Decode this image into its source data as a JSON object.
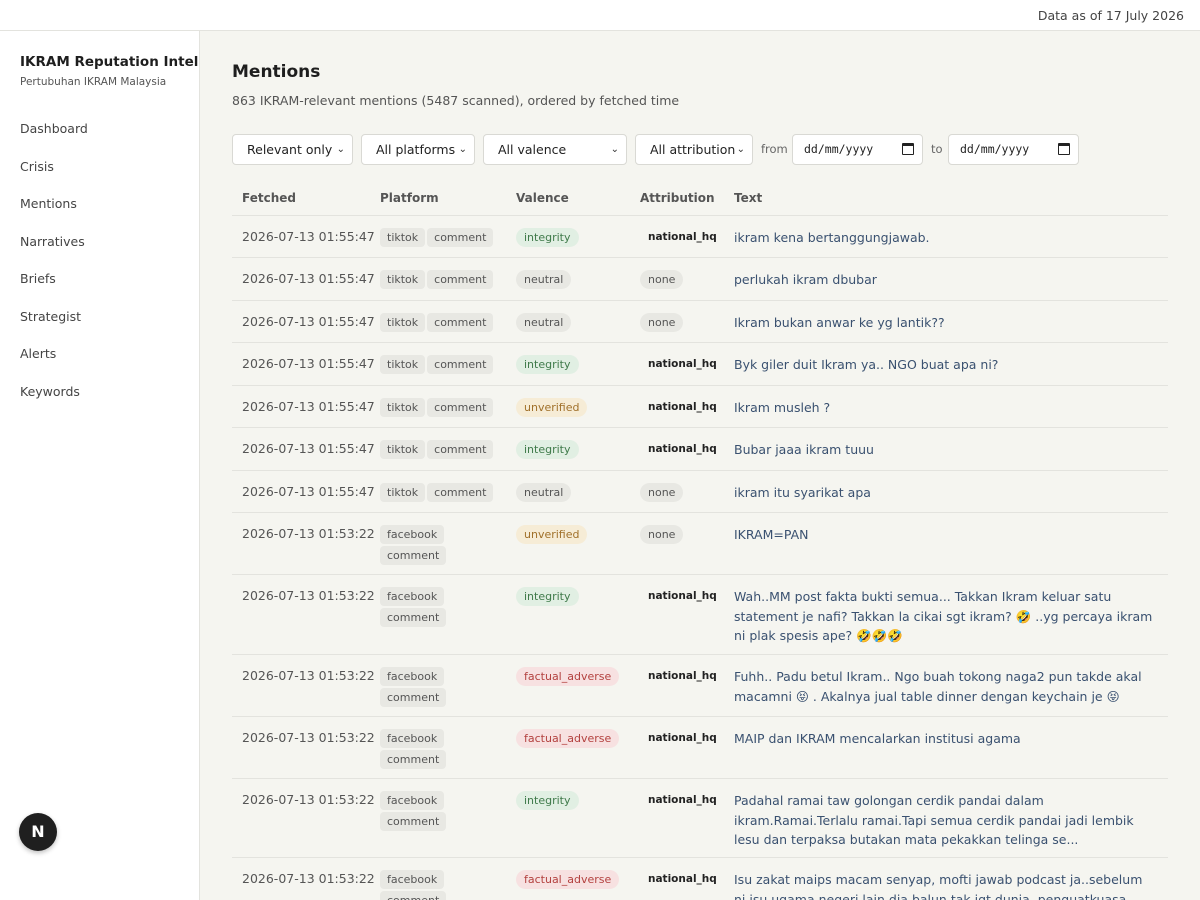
{
  "topbar": {
    "as_of": "Data as of 17 July 2026"
  },
  "sidebar": {
    "brand_title": "IKRAM Reputation Intel",
    "brand_subtitle": "Pertubuhan IKRAM Malaysia",
    "items": [
      {
        "label": "Dashboard"
      },
      {
        "label": "Crisis"
      },
      {
        "label": "Mentions"
      },
      {
        "label": "Narratives"
      },
      {
        "label": "Briefs"
      },
      {
        "label": "Strategist"
      },
      {
        "label": "Alerts"
      },
      {
        "label": "Keywords"
      }
    ],
    "badge": "N"
  },
  "page": {
    "title": "Mentions",
    "subtitle": "863 IKRAM-relevant mentions (5487 scanned), ordered by fetched time"
  },
  "filters": {
    "relevance": "Relevant only",
    "platform": "All platforms",
    "valence": "All valence",
    "attribution": "All attribution",
    "from_label": "from",
    "to_label": "to",
    "from_placeholder": "dd/mm/yyyy",
    "to_placeholder": "dd/mm/yyyy"
  },
  "table": {
    "headers": {
      "fetched": "Fetched",
      "platform": "Platform",
      "valence": "Valence",
      "attribution": "Attribution",
      "text": "Text"
    },
    "rows": [
      {
        "fetched": "2026-07-13 01:55:47",
        "platform": "tiktok",
        "kind": "comment",
        "valence": "integrity",
        "attribution": "national_hq",
        "text": "ikram kena bertanggungjawab."
      },
      {
        "fetched": "2026-07-13 01:55:47",
        "platform": "tiktok",
        "kind": "comment",
        "valence": "neutral",
        "attribution": "none",
        "text": "perlukah ikram dbubar"
      },
      {
        "fetched": "2026-07-13 01:55:47",
        "platform": "tiktok",
        "kind": "comment",
        "valence": "neutral",
        "attribution": "none",
        "text": "Ikram bukan anwar ke yg lantik??"
      },
      {
        "fetched": "2026-07-13 01:55:47",
        "platform": "tiktok",
        "kind": "comment",
        "valence": "integrity",
        "attribution": "national_hq",
        "text": "Byk giler duit Ikram ya.. NGO buat apa ni?"
      },
      {
        "fetched": "2026-07-13 01:55:47",
        "platform": "tiktok",
        "kind": "comment",
        "valence": "unverified",
        "attribution": "national_hq",
        "text": "Ikram musleh ?"
      },
      {
        "fetched": "2026-07-13 01:55:47",
        "platform": "tiktok",
        "kind": "comment",
        "valence": "integrity",
        "attribution": "national_hq",
        "text": "Bubar jaaa ikram tuuu"
      },
      {
        "fetched": "2026-07-13 01:55:47",
        "platform": "tiktok",
        "kind": "comment",
        "valence": "neutral",
        "attribution": "none",
        "text": "ikram itu syarikat apa"
      },
      {
        "fetched": "2026-07-13 01:53:22",
        "platform": "facebook",
        "kind": "comment",
        "valence": "unverified",
        "attribution": "none",
        "text": "IKRAM=PAN"
      },
      {
        "fetched": "2026-07-13 01:53:22",
        "platform": "facebook",
        "kind": "comment",
        "valence": "integrity",
        "attribution": "national_hq",
        "text": "Wah..MM post fakta bukti semua... Takkan Ikram keluar satu statement je nafi? Takkan la cikai sgt ikram? 🤣 ..yg percaya ikram ni plak spesis ape? 🤣🤣🤣"
      },
      {
        "fetched": "2026-07-13 01:53:22",
        "platform": "facebook",
        "kind": "comment",
        "valence": "factual_adverse",
        "attribution": "national_hq",
        "text": "Fuhh.. Padu betul Ikram.. Ngo buah tokong naga2 pun takde akal macamni 😝 . Akalnya jual table dinner dengan keychain je 😝"
      },
      {
        "fetched": "2026-07-13 01:53:22",
        "platform": "facebook",
        "kind": "comment",
        "valence": "factual_adverse",
        "attribution": "national_hq",
        "text": "MAIP dan IKRAM mencalarkan institusi agama"
      },
      {
        "fetched": "2026-07-13 01:53:22",
        "platform": "facebook",
        "kind": "comment",
        "valence": "integrity",
        "attribution": "national_hq",
        "text": "Padahal ramai taw golongan cerdik pandai dalam ikram.Ramai.Terlalu ramai.Tapi semua cerdik pandai jadi lembik lesu dan terpaksa butakan mata pekakkan telinga se..."
      },
      {
        "fetched": "2026-07-13 01:53:22",
        "platform": "facebook",
        "kind": "comment",
        "valence": "factual_adverse",
        "attribution": "national_hq",
        "text": "Isu zakat maips macam senyap, mofti jawab podcast ja..sebelum ni isu ugama negeri lain dia balun tak igt dunia, penguatkuasa pon..."
      }
    ]
  }
}
